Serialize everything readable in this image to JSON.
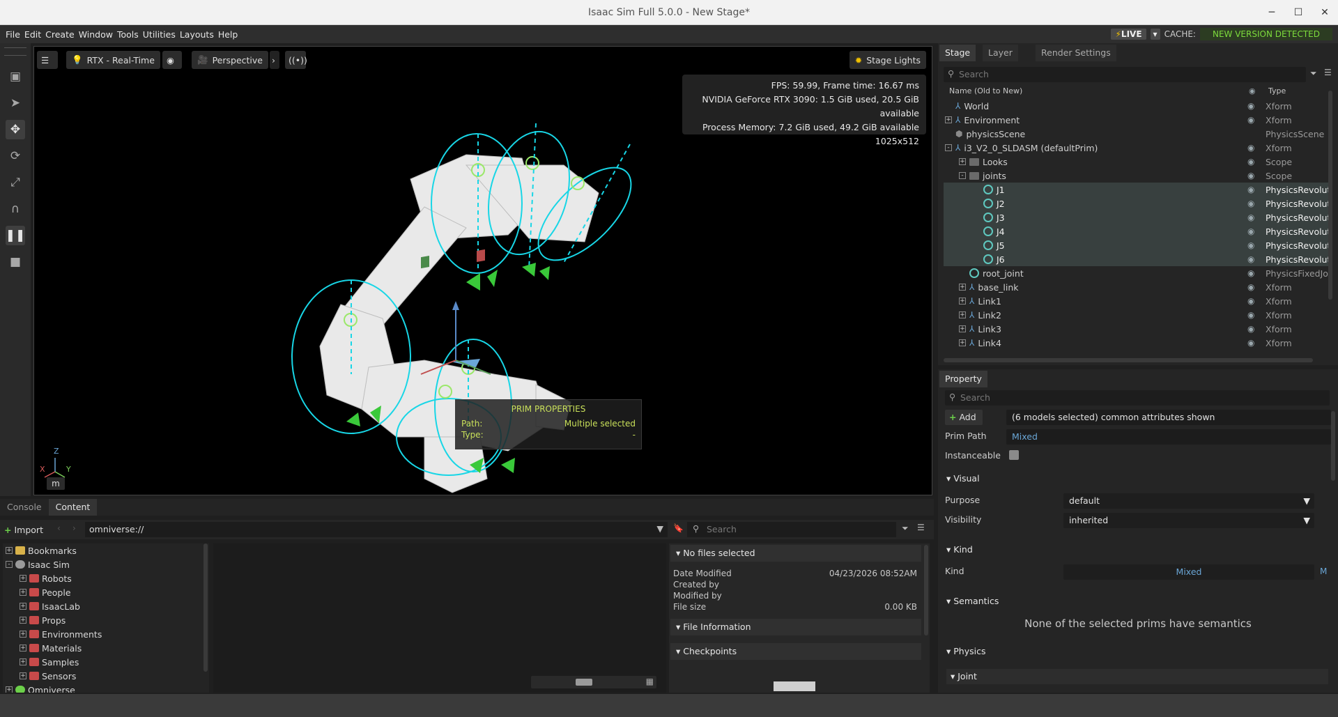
{
  "window": {
    "title": "Isaac Sim Full 5.0.0 - New Stage*"
  },
  "menu": [
    "File",
    "Edit",
    "Create",
    "Window",
    "Tools",
    "Utilities",
    "Layouts",
    "Help"
  ],
  "status": {
    "live": "LIVE",
    "cache": "CACHE:",
    "new_version": "NEW VERSION DETECTED"
  },
  "viewport": {
    "render_mode": "RTX - Real-Time",
    "camera": "Perspective",
    "lights": "Stage Lights",
    "stats": [
      "FPS: 59.99, Frame time: 16.67 ms",
      "NVIDIA GeForce RTX 3090: 1.5 GiB used, 20.5 GiB available",
      "Process Memory: 7.2 GiB used, 49.2 GiB available",
      "1025x512"
    ],
    "prim_props_title": "PRIM PROPERTIES",
    "path_label": "Path:",
    "path_value": "Multiple selected",
    "type_label": "Type:",
    "type_value": "-",
    "unit": "m",
    "axis": {
      "z": "Z",
      "x": "X",
      "y": "Y"
    }
  },
  "bottom_tabs": [
    "Console",
    "Content"
  ],
  "content": {
    "import_label": "Import",
    "path": "omniverse://",
    "search_placeholder": "Search",
    "tree": [
      {
        "label": "Bookmarks",
        "indent": 0,
        "exp": "+"
      },
      {
        "label": "Isaac Sim",
        "indent": 0,
        "exp": "-"
      },
      {
        "label": "Robots",
        "indent": 1,
        "exp": "+"
      },
      {
        "label": "People",
        "indent": 1,
        "exp": "+"
      },
      {
        "label": "IsaacLab",
        "indent": 1,
        "exp": "+"
      },
      {
        "label": "Props",
        "indent": 1,
        "exp": "+"
      },
      {
        "label": "Environments",
        "indent": 1,
        "exp": "+"
      },
      {
        "label": "Materials",
        "indent": 1,
        "exp": "+"
      },
      {
        "label": "Samples",
        "indent": 1,
        "exp": "+"
      },
      {
        "label": "Sensors",
        "indent": 1,
        "exp": "+"
      },
      {
        "label": "Omniverse",
        "indent": 0,
        "exp": "+"
      }
    ],
    "no_files": "No files selected",
    "info": [
      {
        "k": "Date Modified",
        "v": "04/23/2026 08:52AM"
      },
      {
        "k": "Created by",
        "v": ""
      },
      {
        "k": "Modified by",
        "v": ""
      },
      {
        "k": "File size",
        "v": "0.00 KB"
      }
    ],
    "file_information": "File Information",
    "checkpoints": "Checkpoints"
  },
  "stage": {
    "tabs": [
      "Stage",
      "Layer",
      "Render Settings"
    ],
    "search_placeholder": "Search",
    "col_name": "Name (Old to New)",
    "col_type": "Type",
    "rows": [
      {
        "name": "World",
        "type": "Xform",
        "indent": 0,
        "exp": "",
        "icon": "xform",
        "eye": true,
        "sel": false
      },
      {
        "name": "Environment",
        "type": "Xform",
        "indent": 0,
        "exp": "+",
        "icon": "xform",
        "eye": true,
        "sel": false
      },
      {
        "name": "physicsScene",
        "type": "PhysicsScene",
        "indent": 0,
        "exp": "",
        "icon": "cube",
        "eye": false,
        "sel": false
      },
      {
        "name": "i3_V2_0_SLDASM (defaultPrim)",
        "type": "Xform",
        "indent": 0,
        "exp": "-",
        "icon": "xform",
        "eye": true,
        "sel": false
      },
      {
        "name": "Looks",
        "type": "Scope",
        "indent": 1,
        "exp": "+",
        "icon": "folder",
        "eye": true,
        "sel": false
      },
      {
        "name": "joints",
        "type": "Scope",
        "indent": 1,
        "exp": "-",
        "icon": "folder",
        "eye": true,
        "sel": false
      },
      {
        "name": "J1",
        "type": "PhysicsRevoluteJoint",
        "indent": 2,
        "exp": "",
        "icon": "joint",
        "eye": true,
        "sel": true
      },
      {
        "name": "J2",
        "type": "PhysicsRevoluteJoint",
        "indent": 2,
        "exp": "",
        "icon": "joint",
        "eye": true,
        "sel": true
      },
      {
        "name": "J3",
        "type": "PhysicsRevoluteJoint",
        "indent": 2,
        "exp": "",
        "icon": "joint",
        "eye": true,
        "sel": true
      },
      {
        "name": "J4",
        "type": "PhysicsRevoluteJoint",
        "indent": 2,
        "exp": "",
        "icon": "joint",
        "eye": true,
        "sel": true
      },
      {
        "name": "J5",
        "type": "PhysicsRevoluteJoint",
        "indent": 2,
        "exp": "",
        "icon": "joint",
        "eye": true,
        "sel": true
      },
      {
        "name": "J6",
        "type": "PhysicsRevoluteJoint",
        "indent": 2,
        "exp": "",
        "icon": "joint",
        "eye": true,
        "sel": true
      },
      {
        "name": "root_joint",
        "type": "PhysicsFixedJoint",
        "indent": 1,
        "exp": "",
        "icon": "joint",
        "eye": true,
        "sel": false
      },
      {
        "name": "base_link",
        "type": "Xform",
        "indent": 1,
        "exp": "+",
        "icon": "xform",
        "eye": true,
        "sel": false
      },
      {
        "name": "Link1",
        "type": "Xform",
        "indent": 1,
        "exp": "+",
        "icon": "xform",
        "eye": true,
        "sel": false
      },
      {
        "name": "Link2",
        "type": "Xform",
        "indent": 1,
        "exp": "+",
        "icon": "xform",
        "eye": true,
        "sel": false
      },
      {
        "name": "Link3",
        "type": "Xform",
        "indent": 1,
        "exp": "+",
        "icon": "xform",
        "eye": true,
        "sel": false
      },
      {
        "name": "Link4",
        "type": "Xform",
        "indent": 1,
        "exp": "+",
        "icon": "xform",
        "eye": true,
        "sel": false
      }
    ]
  },
  "property": {
    "tab": "Property",
    "search_placeholder": "Search",
    "add_label": "Add",
    "selection_note": "(6 models selected) common attributes shown",
    "prim_path_label": "Prim Path",
    "prim_path_value": "Mixed",
    "instanceable_label": "Instanceable",
    "visual_header": "Visual",
    "purpose_label": "Purpose",
    "purpose_value": "default",
    "visibility_label": "Visibility",
    "visibility_value": "inherited",
    "kind_header": "Kind",
    "kind_label": "Kind",
    "kind_value": "Mixed",
    "kind_flag": "M",
    "semantics_header": "Semantics",
    "semantics_note": "None of the selected prims have semantics",
    "physics_header": "Physics",
    "joint_header": "Joint"
  },
  "colors": {
    "accent_green": "#7ddc3c",
    "selection": "#38403f",
    "joint_cyan": "#18d6e6"
  }
}
